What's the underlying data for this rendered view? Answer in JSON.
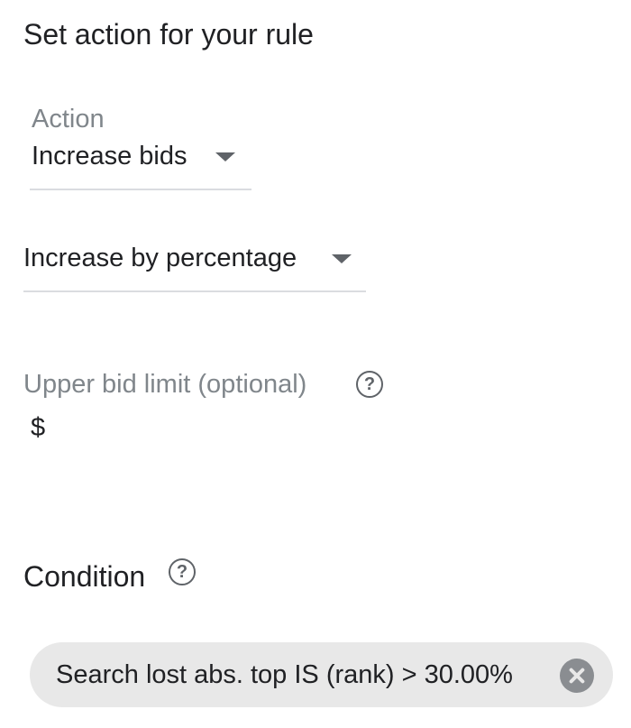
{
  "section": {
    "title": "Set action for your rule"
  },
  "action": {
    "label": "Action",
    "value": "Increase bids"
  },
  "adjustment": {
    "value": "Increase by percentage"
  },
  "upper_bid_limit": {
    "label": "Upper bid limit (optional)",
    "currency_prefix": "$",
    "value": ""
  },
  "condition": {
    "heading": "Condition",
    "chips": [
      {
        "text": "Search lost abs. top IS (rank) > 30.00%"
      }
    ]
  },
  "icons": {
    "help": "help-circle-icon",
    "dropdown": "dropdown-arrow-icon",
    "remove": "close-circle-icon"
  },
  "colors": {
    "text_primary": "#202124",
    "text_secondary": "#80868b",
    "icon": "#5f6368",
    "underline": "#dadce0",
    "chip_bg": "#e8e8e8"
  }
}
